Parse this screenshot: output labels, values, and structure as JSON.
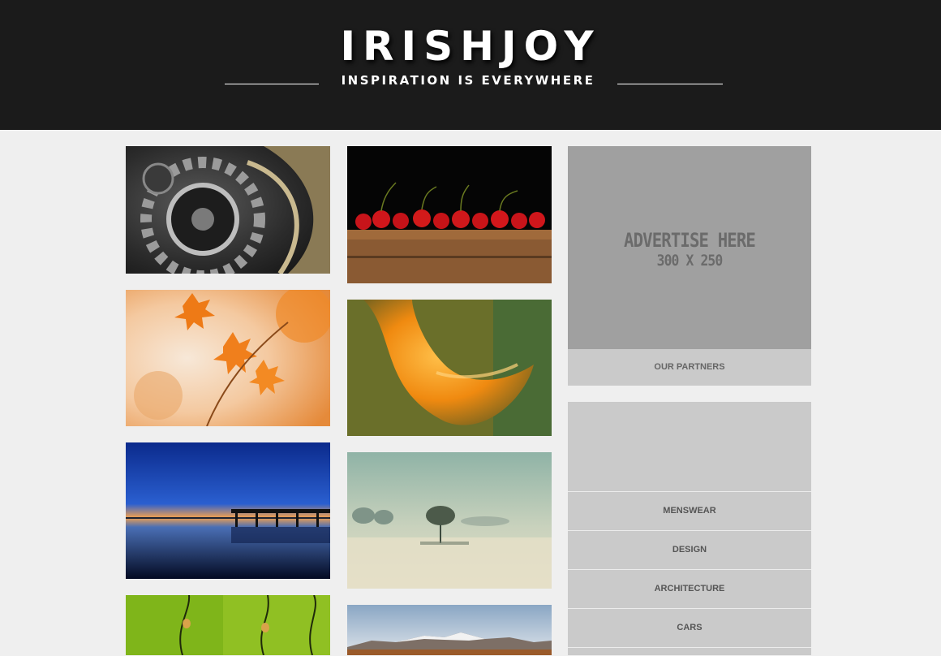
{
  "header": {
    "logo": "IRISHJOY",
    "tagline": "INSPIRATION IS EVERYWHERE"
  },
  "gallery": {
    "column_left": [
      {
        "subject": "clock gears"
      },
      {
        "subject": "orange autumn maple leaves"
      },
      {
        "subject": "pier at blue dusk"
      },
      {
        "subject": "green stems with buds"
      }
    ],
    "column_right": [
      {
        "subject": "cherries on wooden crate"
      },
      {
        "subject": "orange flower petal macro"
      },
      {
        "subject": "trees in foggy field"
      },
      {
        "subject": "snowy mountain range"
      }
    ]
  },
  "sidebar": {
    "ad": {
      "line1": "ADVERTISE HERE",
      "line2": "300 X 250"
    },
    "partners_label": "OUR PARTNERS",
    "categories": [
      {
        "label": "MENSWEAR"
      },
      {
        "label": "DESIGN"
      },
      {
        "label": "ARCHITECTURE"
      },
      {
        "label": "CARS"
      }
    ]
  },
  "colors": {
    "header_bg": "#1b1b1b",
    "page_bg": "#efefef",
    "ad_bg": "#a0a0a0",
    "panel_bg": "#cacaca"
  }
}
